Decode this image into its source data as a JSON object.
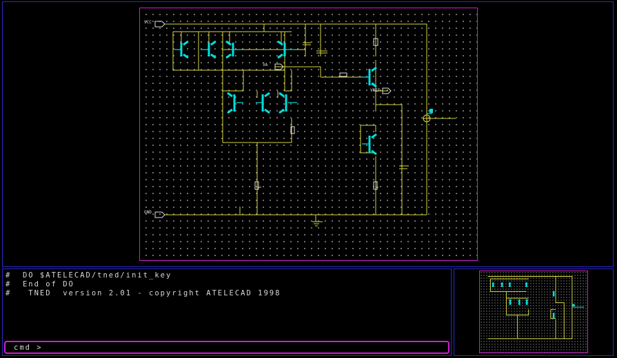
{
  "app": {
    "name": "TNED"
  },
  "schematic": {
    "net_labels": [
      "VCC",
      "GND",
      "VA",
      "VREF"
    ]
  },
  "console": {
    "lines": [
      "#  DO $ATELECAD/tned/init_key",
      "#  End of DO",
      "#   TNED  version 2.01 - copyright ATELECAD 1998"
    ],
    "prompt": "cmd >",
    "input_value": ""
  },
  "colors": {
    "wire": "#d8d840",
    "device": "#00e0e0",
    "sheet_border": "#d020d0",
    "pane_border": "#2a2acc"
  }
}
